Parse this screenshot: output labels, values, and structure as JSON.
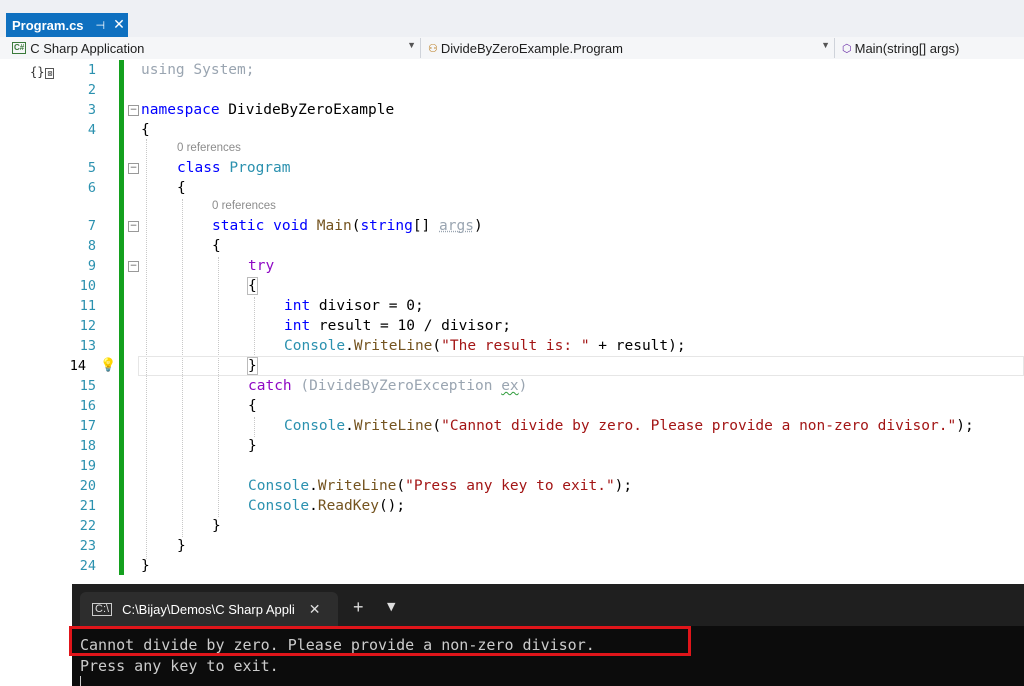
{
  "tab": {
    "title": "Program.cs",
    "pin": "⊣",
    "close": "✕"
  },
  "nav": {
    "project": "C Sharp Application",
    "project_badge": "C#",
    "type": "DivideByZeroExample.Program",
    "member": "Main(string[] args)"
  },
  "editor": {
    "line_numbers": [
      "1",
      "2",
      "3",
      "4",
      "5",
      "6",
      "7",
      "8",
      "9",
      "10",
      "11",
      "12",
      "13",
      "14",
      "15",
      "16",
      "17",
      "18",
      "19",
      "20",
      "21",
      "22",
      "23",
      "24"
    ],
    "refs_label": "0 references",
    "l1_using": "using",
    "l1_system": " System;",
    "l3_namespace": "namespace",
    "l3_name": " DivideByZeroExample",
    "open_brace": "{",
    "close_brace": "}",
    "l5_class": "class",
    "l5_name": " Program",
    "l7_static": "static",
    "l7_void": " void",
    "l7_main": " Main",
    "l7_paren": "(",
    "l7_string": "string",
    "l7_arr": "[] ",
    "l7_args": "args",
    "l7_end": ")",
    "l9_try": "try",
    "l11_int": "int",
    "l11_rest": " divisor = 0;",
    "l12_int": "int",
    "l12_rest": " result = 10 / divisor;",
    "console": "Console",
    "dot": ".",
    "writeline": "WriteLine",
    "readkey": "ReadKey",
    "l13_open": "(",
    "l13_str": "\"The result is: \"",
    "l13_rest": " + result);",
    "l15_catch": "catch",
    "l15_open": " (",
    "l15_type": "DivideByZeroException",
    "l15_sp": " ",
    "l15_ex": "ex",
    "l15_close": ")",
    "l17_str": "\"Cannot divide by zero. Please provide a non-zero divisor.\"",
    "l17_end": ");",
    "l20_str": "\"Press any key to exit.\"",
    "l21_end": "();"
  },
  "terminal": {
    "tab_title": "C:\\Bijay\\Demos\\C Sharp Appli",
    "tab_icon": "C:\\",
    "close": "✕",
    "plus": "+",
    "dropdown": "⌄",
    "output_line1": "Cannot divide by zero. Please provide a non-zero divisor.",
    "output_line2": "Press any key to exit."
  },
  "colors": {
    "accent": "#0e70c0",
    "highlight": "#e0151a",
    "changebar": "#14a01e"
  },
  "icons": {
    "pin": "pin-icon",
    "close": "close-icon",
    "lightbulb": "lightbulb-icon",
    "fold": "fold-icon"
  }
}
